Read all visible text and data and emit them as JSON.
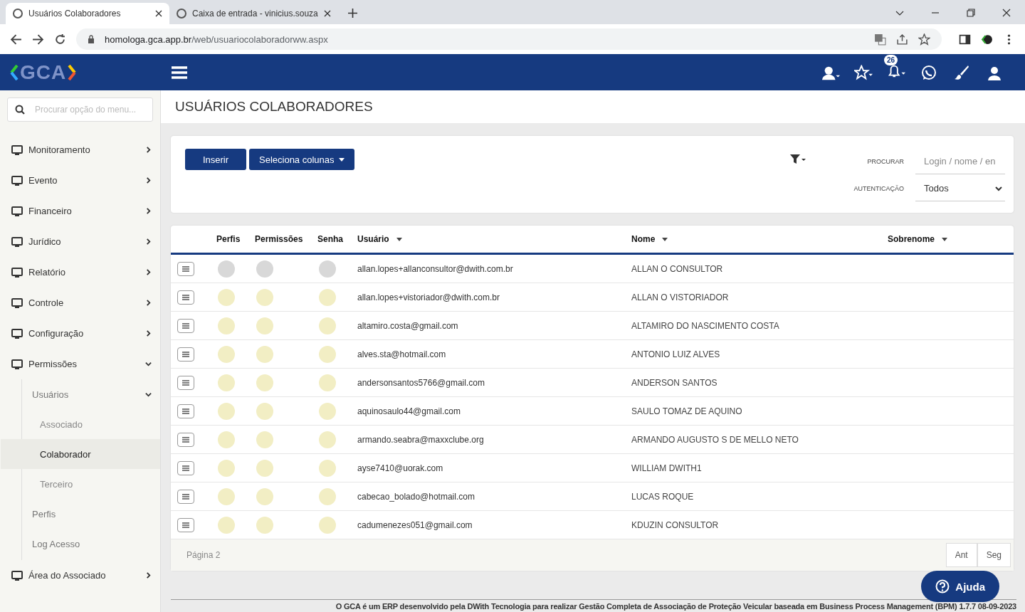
{
  "browser": {
    "tabs": [
      {
        "title": "Usuários Colaboradores",
        "selected": true
      },
      {
        "title": "Caixa de entrada - vinicius.souza",
        "selected": false
      }
    ],
    "url_host": "homologa.gca.app.br",
    "url_path": "/web/usuariocolaboradorww.aspx"
  },
  "app_header": {
    "logo": "GCA",
    "notification_count": "26"
  },
  "sidebar": {
    "search_placeholder": "Procurar opção do menu...",
    "items": [
      {
        "label": "Monitoramento",
        "expanded": false
      },
      {
        "label": "Evento",
        "expanded": false
      },
      {
        "label": "Financeiro",
        "expanded": false
      },
      {
        "label": "Jurídico",
        "expanded": false
      },
      {
        "label": "Relatório",
        "expanded": false
      },
      {
        "label": "Controle",
        "expanded": false
      },
      {
        "label": "Configuração",
        "expanded": false
      },
      {
        "label": "Permissões",
        "expanded": true,
        "children": [
          {
            "label": "Usuários",
            "expanded": true,
            "children": [
              {
                "label": "Associado",
                "selected": false
              },
              {
                "label": "Colaborador",
                "selected": true
              },
              {
                "label": "Terceiro",
                "selected": false
              }
            ]
          },
          {
            "label": "Perfis"
          },
          {
            "label": "Log Acesso"
          }
        ]
      },
      {
        "label": "Área do Associado",
        "expanded": false
      }
    ]
  },
  "page_title": "USUÁRIOS COLABORADORES",
  "toolbar": {
    "buttons": [
      {
        "label": "Inserir",
        "dropdown": false
      },
      {
        "label": "Seleciona colunas",
        "dropdown": true
      }
    ],
    "search_label": "PROCURAR",
    "search_placeholder": "Login / nome / en",
    "auth_label": "AUTENTICAÇÃO",
    "auth_value": "Todos"
  },
  "table": {
    "columns": [
      {
        "label": "Perfis",
        "sortable": false
      },
      {
        "label": "Permissões",
        "sortable": false
      },
      {
        "label": "Senha",
        "sortable": false
      },
      {
        "label": "Usuário",
        "sortable": true
      },
      {
        "label": "Nome",
        "sortable": true
      },
      {
        "label": "Sobrenome",
        "sortable": true
      }
    ],
    "rows": [
      {
        "usuario": "allan.lopes+allanconsultor@dwith.com.br",
        "nome": "ALLAN O CONSULTOR",
        "hovered": true
      },
      {
        "usuario": "allan.lopes+vistoriador@dwith.com.br",
        "nome": "ALLAN O VISTORIADOR",
        "hovered": false
      },
      {
        "usuario": "altamiro.costa@gmail.com",
        "nome": "ALTAMIRO DO NASCIMENTO COSTA",
        "hovered": false
      },
      {
        "usuario": "alves.sta@hotmail.com",
        "nome": "ANTONIO LUIZ ALVES",
        "hovered": false
      },
      {
        "usuario": "andersonsantos5766@gmail.com",
        "nome": "ANDERSON SANTOS",
        "hovered": false
      },
      {
        "usuario": "aquinosaulo44@gmail.com",
        "nome": "SAULO TOMAZ DE AQUINO",
        "hovered": false
      },
      {
        "usuario": "armando.seabra@maxxclube.org",
        "nome": "ARMANDO AUGUSTO S DE MELLO NETO",
        "hovered": false
      },
      {
        "usuario": "ayse7410@uorak.com",
        "nome": "WILLIAM DWITH1",
        "hovered": false
      },
      {
        "usuario": "cabecao_bolado@hotmail.com",
        "nome": "LUCAS ROQUE",
        "hovered": false
      },
      {
        "usuario": "cadumenezes051@gmail.com",
        "nome": "KDUZIN CONSULTOR",
        "hovered": false
      }
    ],
    "page_label": "Página 2",
    "pager": [
      "Ant",
      "Seg"
    ]
  },
  "help_button": "Ajuda",
  "footer": "O GCA é um ERP desenvolvido pela DWith Tecnologia para realizar Gestão Completa de Associação de Proteção Veicular baseada em Business Process Management (BPM) 1.7.7 08-09-2023"
}
